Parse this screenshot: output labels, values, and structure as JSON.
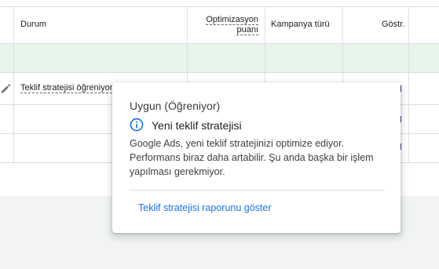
{
  "table": {
    "columns": {
      "status": "Durum",
      "optimization_line1": "Optimizasyon",
      "optimization_line2": "puanı",
      "campaign_type": "Kampanya türü",
      "impressions": "Göstr."
    },
    "rows": [
      {
        "status": "Teklif stratejisi öğreniyor"
      }
    ]
  },
  "tooltip": {
    "title": "Uygun (Öğreniyor)",
    "subtitle": "Yeni teklif stratejisi",
    "body": "Google Ads, yeni teklif stratejinizi optimize ediyor. Performans biraz daha artabilir. Şu anda başka bir işlem yapılması gerekmiyor.",
    "link": "Teklif stratejisi raporunu göster",
    "icon": "info-icon",
    "icon_color": "#1a73e8",
    "link_color": "#1a73e8"
  },
  "colors": {
    "summary_row": "#e6f4ea"
  }
}
